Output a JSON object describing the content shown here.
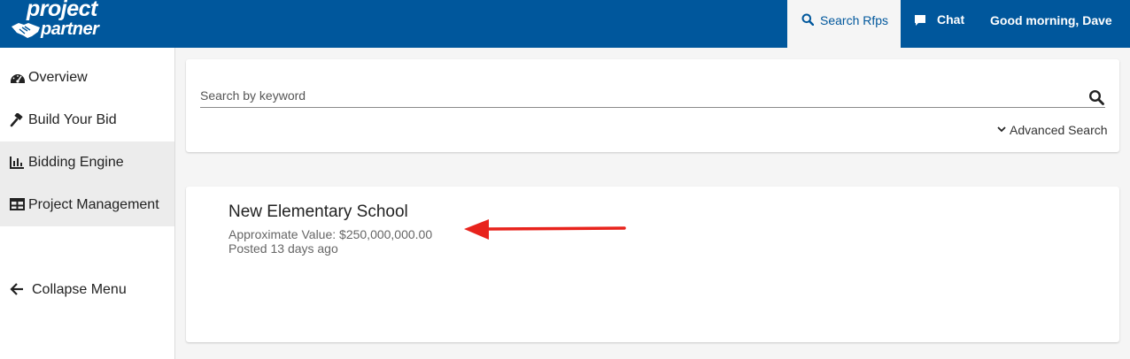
{
  "brand": {
    "line1": "project",
    "line2": "partner"
  },
  "header": {
    "search_tab": "Search Rfps",
    "chat": "Chat",
    "greeting": "Good morning, Dave"
  },
  "sidebar": {
    "items": [
      {
        "label": "Overview",
        "icon": "dashboard-icon"
      },
      {
        "label": "Build Your Bid",
        "icon": "gavel-icon"
      },
      {
        "label": "Bidding Engine",
        "icon": "bar-chart-icon",
        "active": true
      },
      {
        "label": "Project Management",
        "icon": "table-icon",
        "active": true
      },
      {
        "label": "Collapse Menu",
        "icon": "arrow-left-icon"
      }
    ]
  },
  "search": {
    "placeholder": "Search by keyword",
    "advanced": "Advanced Search"
  },
  "results": [
    {
      "title": "New Elementary School",
      "value": "Approximate Value: $250,000,000.00",
      "posted": "Posted 13 days ago"
    }
  ],
  "colors": {
    "brand": "#00579c",
    "annotation_arrow": "#e8231c"
  }
}
